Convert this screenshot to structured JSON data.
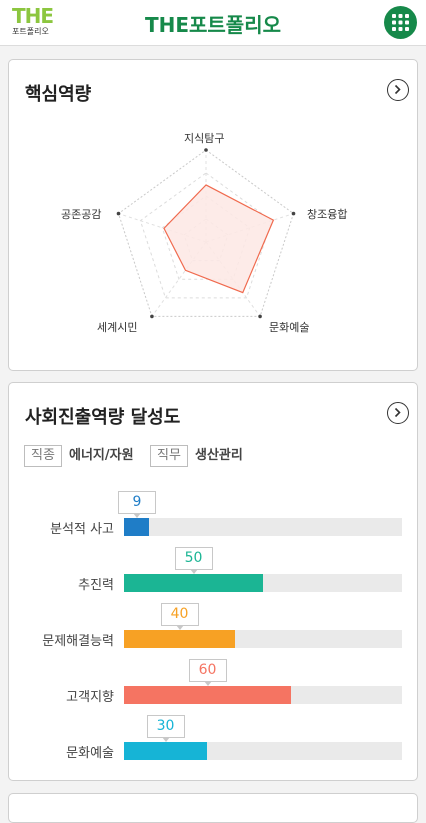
{
  "header": {
    "logo_text": "THE",
    "logo_sub": "포트폴리오",
    "title": "THE포트폴리오",
    "menu_icon": "grid-menu-icon"
  },
  "core": {
    "title": "핵심역량",
    "radar": {
      "axes": [
        "지식탐구",
        "창조융합",
        "문화예술",
        "세계시민",
        "공존공감"
      ],
      "values": [
        0.62,
        0.77,
        0.68,
        0.38,
        0.48
      ],
      "levels": 4,
      "fill_color": "#fde8e4",
      "line_color": "#f06a4e"
    }
  },
  "career": {
    "title": "사회진출역량 달성도",
    "tags": [
      {
        "label": "직종",
        "value": "에너지/자원"
      },
      {
        "label": "직무",
        "value": "생산관리"
      }
    ],
    "chart_data": {
      "type": "bar",
      "categories": [
        "분석적 사고",
        "추진력",
        "문제해결능력",
        "고객지향",
        "문화예술"
      ],
      "values": [
        9,
        50,
        40,
        60,
        30
      ],
      "value_labels": [
        "9",
        "50",
        "40",
        "60",
        "30"
      ],
      "colors": [
        "#1f7dc7",
        "#1bb594",
        "#f7a124",
        "#f57462",
        "#16b4d6"
      ],
      "ylim": [
        0,
        100
      ]
    }
  }
}
